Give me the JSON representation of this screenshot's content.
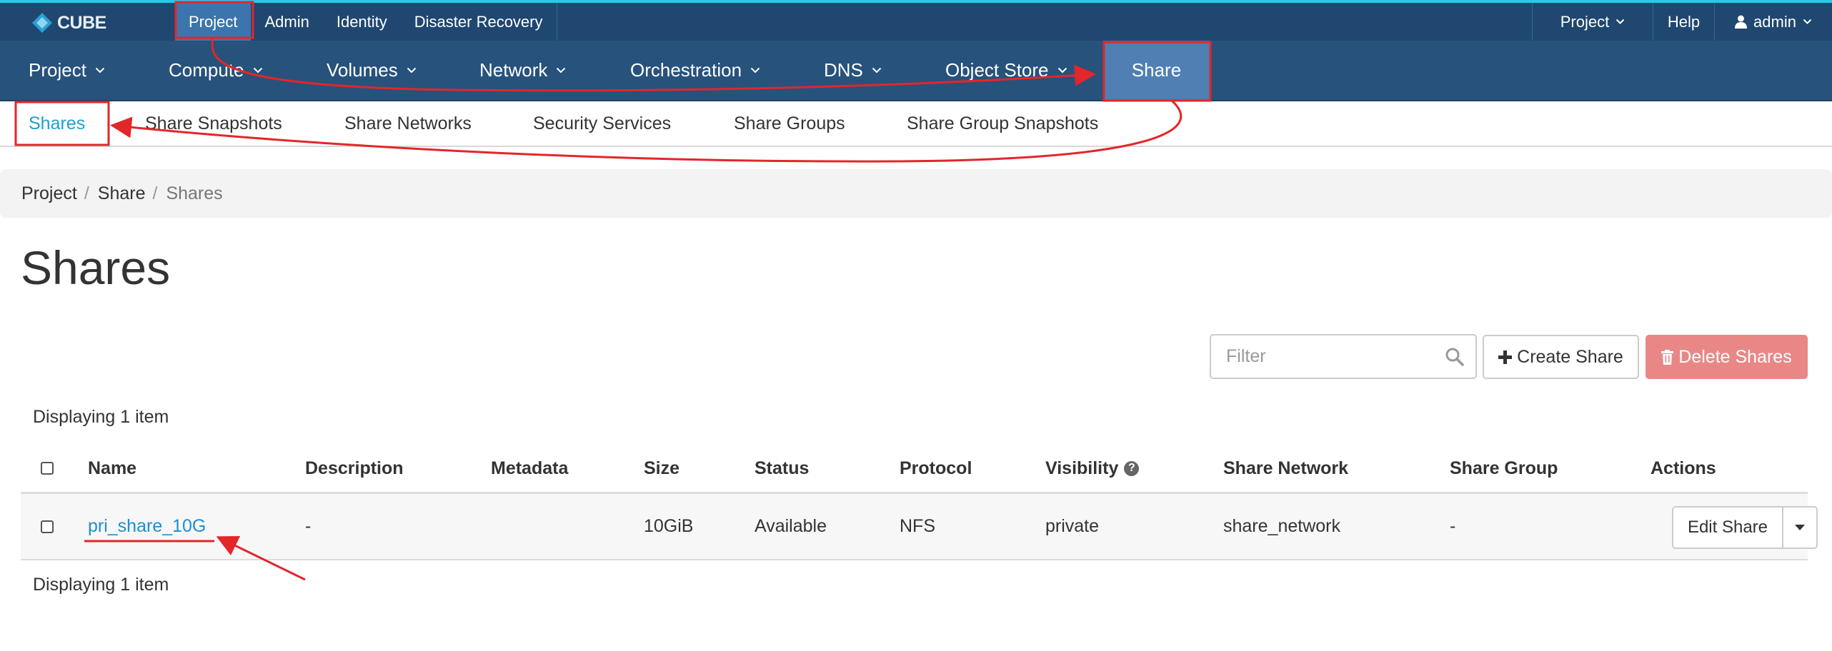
{
  "brand": {
    "name": "CUBE"
  },
  "top_nav": [
    "Project",
    "Admin",
    "Identity",
    "Disaster Recovery"
  ],
  "top_right": {
    "project": "Project",
    "help": "Help",
    "user": "admin"
  },
  "main_nav": [
    "Project",
    "Compute",
    "Volumes",
    "Network",
    "Orchestration",
    "DNS",
    "Object Store",
    "Share"
  ],
  "sub_nav": [
    "Shares",
    "Share Snapshots",
    "Share Networks",
    "Security Services",
    "Share Groups",
    "Share Group Snapshots"
  ],
  "breadcrumb": [
    "Project",
    "Share",
    "Shares"
  ],
  "page": {
    "title": "Shares"
  },
  "toolbar": {
    "filter_placeholder": "Filter",
    "create_label": "Create Share",
    "delete_label": "Delete Shares"
  },
  "table": {
    "display_count": "Displaying 1 item",
    "columns": [
      "Name",
      "Description",
      "Metadata",
      "Size",
      "Status",
      "Protocol",
      "Visibility",
      "Share Network",
      "Share Group",
      "Actions"
    ],
    "rows": [
      {
        "name": "pri_share_10G",
        "description": "-",
        "metadata": "",
        "size": "10GiB",
        "status": "Available",
        "protocol": "NFS",
        "visibility": "private",
        "share_network": "share_network",
        "share_group": "-",
        "action": "Edit Share"
      }
    ]
  },
  "colors": {
    "top_bar": "#1f4770",
    "main_bar": "#27527c",
    "active_nav": "#4f7fb3",
    "link": "#1c8fd3",
    "danger": "#e98787",
    "annotation": "#e3262a"
  }
}
